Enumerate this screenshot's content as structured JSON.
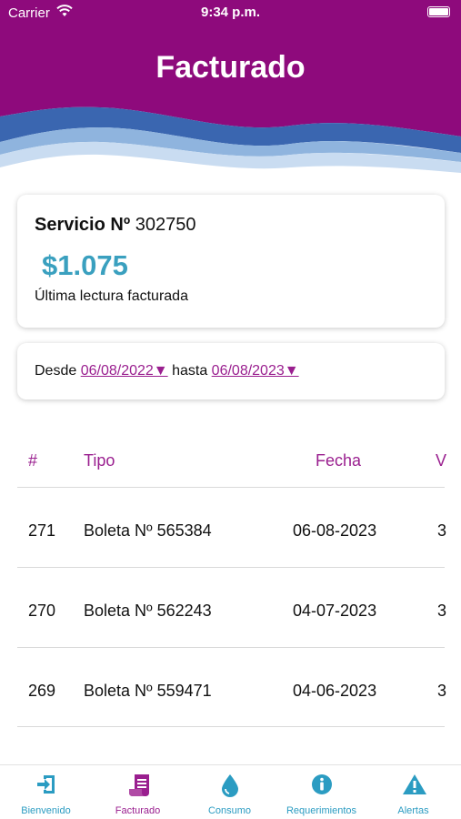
{
  "status_bar": {
    "carrier": "Carrier",
    "time": "9:34 p.m."
  },
  "header": {
    "title": "Facturado"
  },
  "service": {
    "label": "Servicio Nº",
    "number": "302750",
    "amount": "$1.075",
    "caption": "Última lectura facturada"
  },
  "range": {
    "from_label": "Desde",
    "from_date": "06/08/2022▼",
    "to_label": "hasta",
    "to_date": "06/08/2023▼"
  },
  "table": {
    "headers": [
      "#",
      "Tipo",
      "Fecha",
      "V"
    ],
    "rows": [
      {
        "num": "271",
        "tipo": "Boleta Nº 565384",
        "fecha": "06-08-2023",
        "valor": "3"
      },
      {
        "num": "270",
        "tipo": "Boleta Nº 562243",
        "fecha": "04-07-2023",
        "valor": "3"
      },
      {
        "num": "269",
        "tipo": "Boleta Nº 559471",
        "fecha": "04-06-2023",
        "valor": "3"
      }
    ]
  },
  "tabs": [
    {
      "label": "Bienvenido",
      "icon": "login-icon"
    },
    {
      "label": "Facturado",
      "icon": "receipt-icon",
      "active": true
    },
    {
      "label": "Consumo",
      "icon": "water-drop-icon"
    },
    {
      "label": "Requerimientos",
      "icon": "info-icon"
    },
    {
      "label": "Alertas",
      "icon": "alert-triangle-icon"
    }
  ],
  "colors": {
    "header_purple": "#8e0a7c",
    "wave_blue": "#3a66b0",
    "accent_purple": "#9a1f8f",
    "accent_blue": "#2b9cc2",
    "amount_blue": "#3aa0bf"
  }
}
